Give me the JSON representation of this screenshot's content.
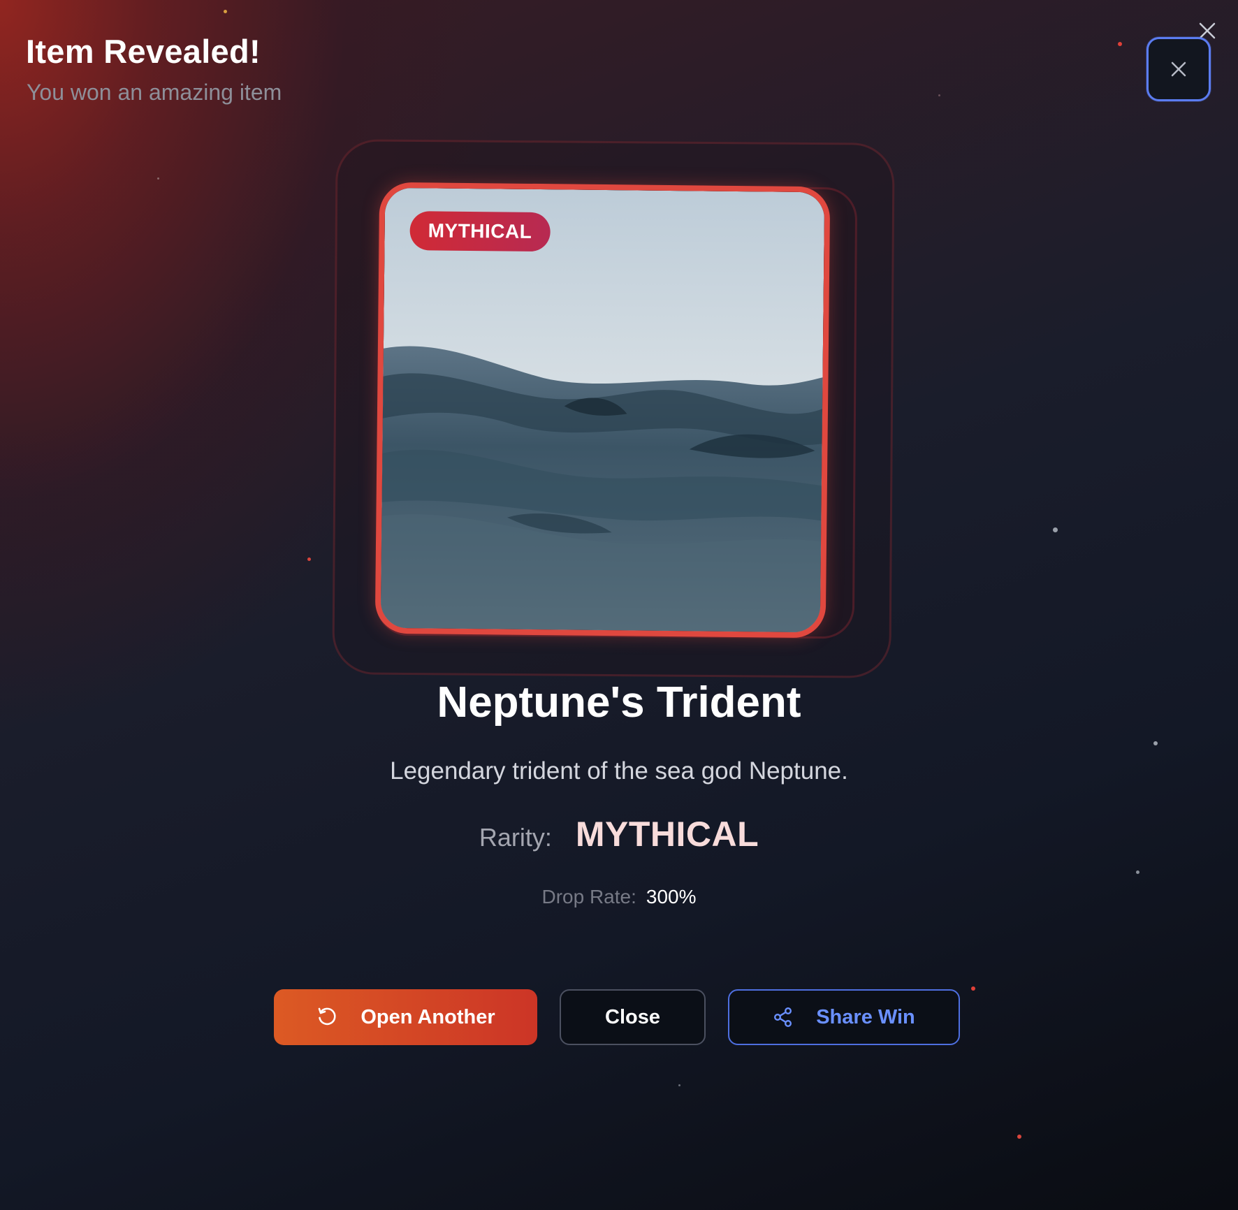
{
  "window": {
    "close_icon": "close-icon"
  },
  "header": {
    "title": "Item Revealed!",
    "subtitle": "You won an amazing item",
    "close_icon": "close-icon"
  },
  "item": {
    "badge": "MYTHICAL",
    "image": "ocean-waves-image",
    "name": "Neptune's Trident",
    "description": "Legendary trident of the sea god Neptune.",
    "rarity_label": "Rarity:",
    "rarity_value": "MYTHICAL",
    "drop_rate_label": "Drop Rate:",
    "drop_rate_value": "300%"
  },
  "actions": {
    "open_another": {
      "label": "Open Another",
      "icon": "refresh-icon"
    },
    "close": {
      "label": "Close"
    },
    "share": {
      "label": "Share Win",
      "icon": "share-icon"
    }
  },
  "colors": {
    "accent_red": "#e0483f",
    "primary_orange": "#dc5a24",
    "share_blue": "#5b7cf0",
    "rarity_text": "#f8dcdb"
  }
}
